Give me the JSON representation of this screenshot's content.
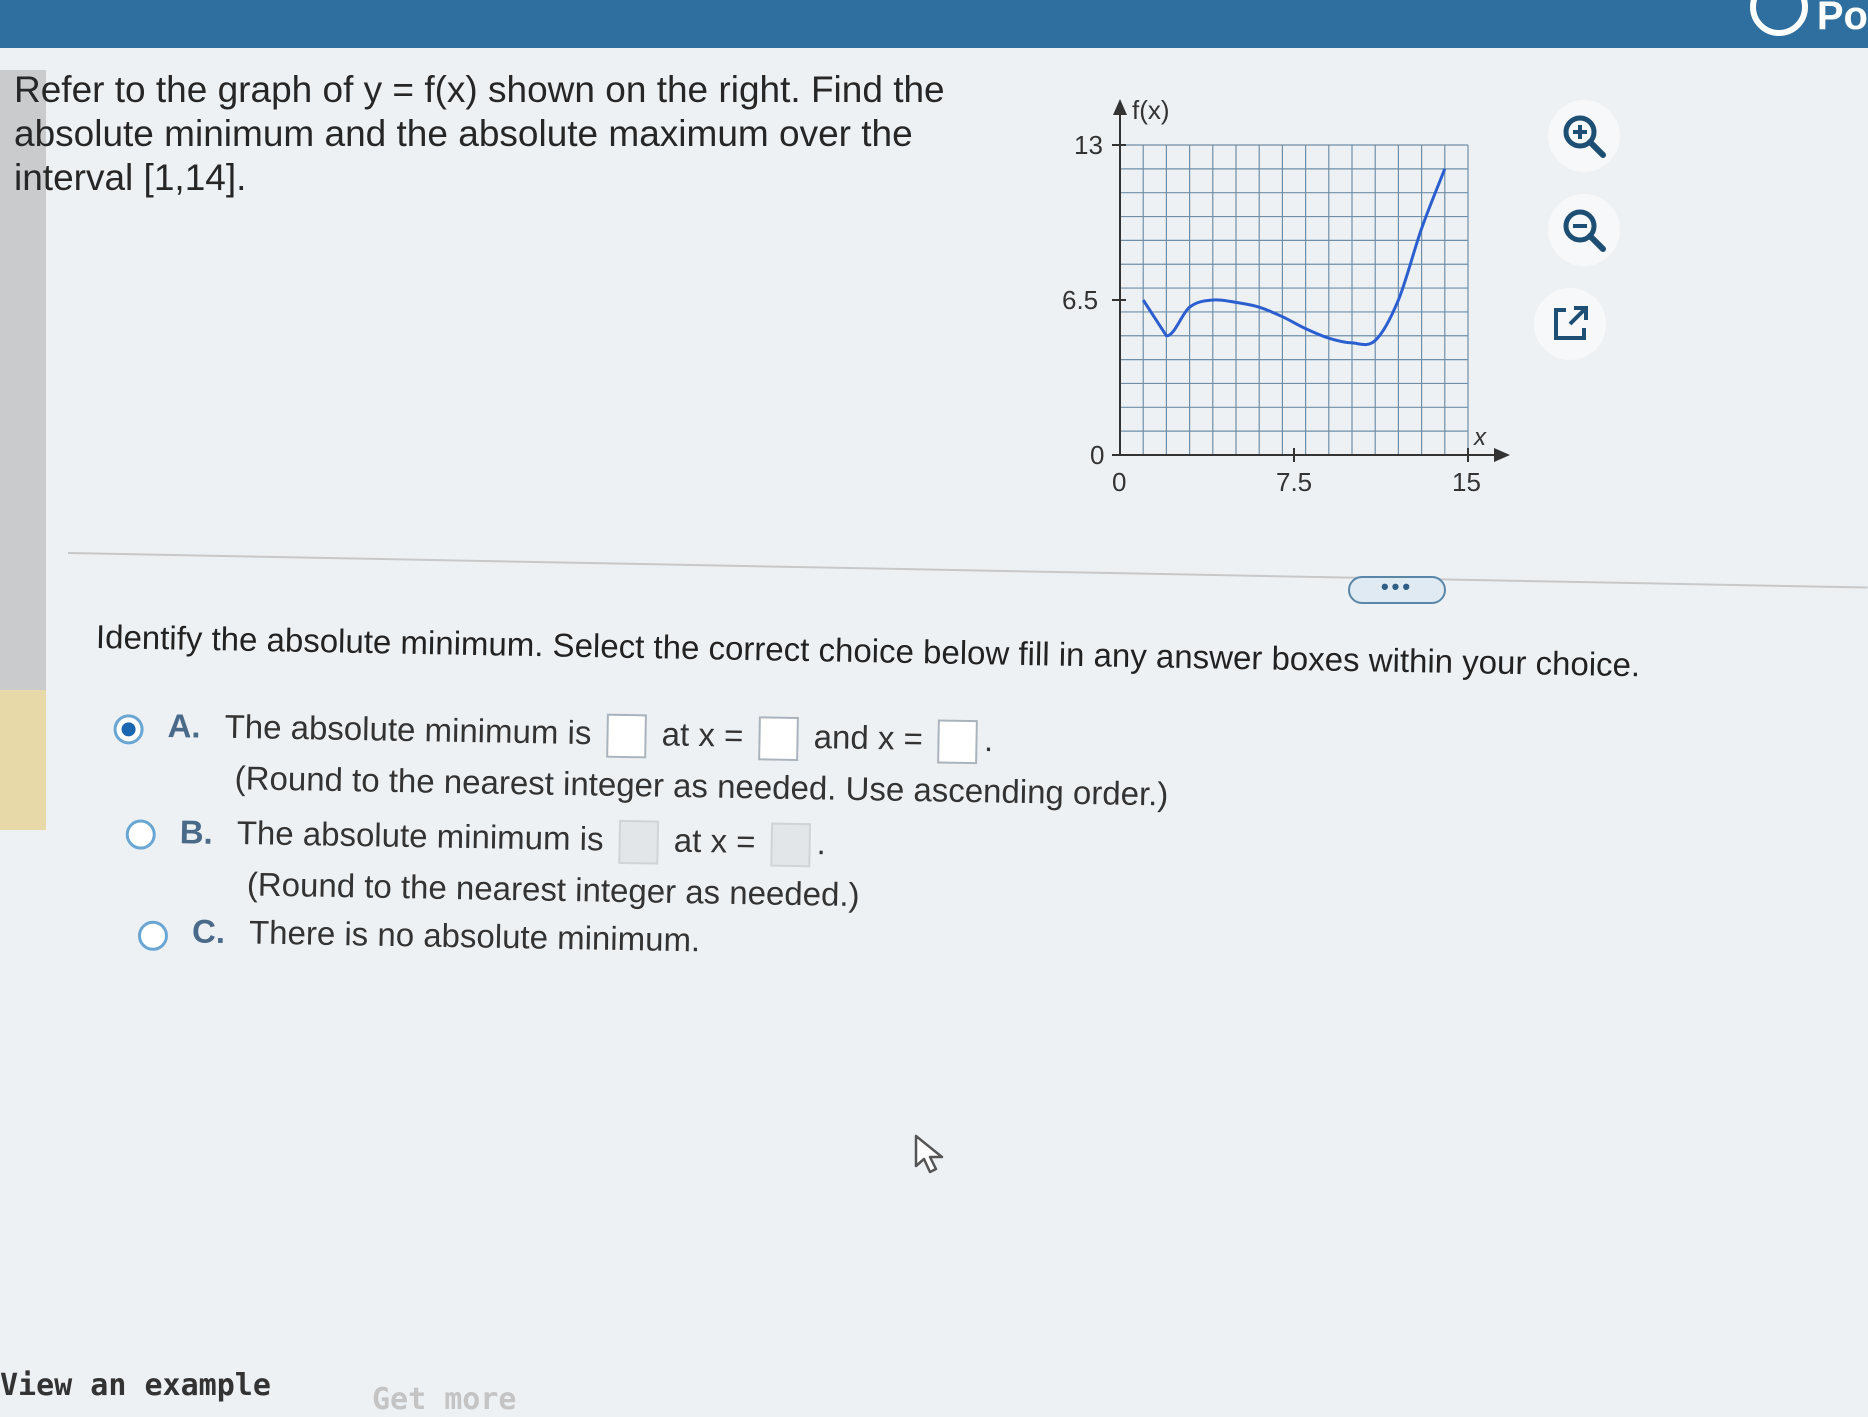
{
  "header": {
    "brand_text": "Po"
  },
  "question": {
    "line1": "Refer to the graph of y = f(x) shown on the right. Find the",
    "line2": "absolute minimum and the absolute maximum over the",
    "line3": "interval [1,14]."
  },
  "graph": {
    "y_axis_label": "f(x)",
    "x_axis_label": "x",
    "y_ticks": [
      "13",
      "6.5",
      "0"
    ],
    "x_ticks": [
      "0",
      "7.5",
      "15"
    ],
    "curve_color": "#2b5fd0",
    "grid_color": "#6f8fa8"
  },
  "chart_data": {
    "type": "line",
    "x": [
      1,
      2,
      3,
      4,
      5,
      6,
      7,
      8,
      9,
      10,
      11,
      12,
      13,
      14
    ],
    "y": [
      6.5,
      5,
      6.2,
      6.5,
      6.4,
      6.2,
      5.8,
      5.3,
      4.9,
      4.7,
      4.8,
      6.5,
      9.5,
      12
    ],
    "xlim": [
      0,
      15
    ],
    "ylim": [
      0,
      13
    ],
    "grid": true
  },
  "tools": {
    "zoom_in": "zoom-in-icon",
    "zoom_out": "zoom-out-icon",
    "popout": "external-link-icon"
  },
  "more_label": "•••",
  "instruction": "Identify the absolute minimum. Select the correct choice below fill in any answer boxes within your choice.",
  "choices": {
    "a": {
      "letter": "A.",
      "text1": "The absolute minimum is",
      "text2": "at x =",
      "text3": "and x =",
      "note": "(Round to the nearest integer as needed. Use ascending order.)",
      "selected": true
    },
    "b": {
      "letter": "B.",
      "text1": "The absolute minimum is",
      "text2": "at x =",
      "note": "(Round to the nearest integer as needed.)",
      "selected": false
    },
    "c": {
      "letter": "C.",
      "text1": "There is no absolute minimum.",
      "selected": false
    }
  },
  "footer": {
    "view_example": "View an example",
    "get_more": "Get more"
  }
}
